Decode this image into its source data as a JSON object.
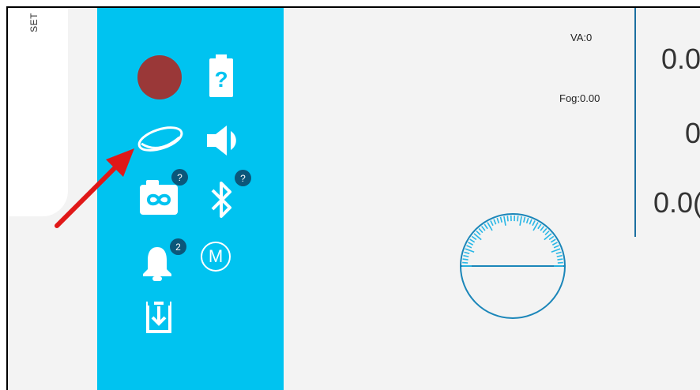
{
  "left_panel": {
    "label": "SET"
  },
  "sidebar": {
    "icons": [
      {
        "name": "record-indicator",
        "color": "#9a3838"
      },
      {
        "name": "battery-unknown-icon"
      },
      {
        "name": "lens-icon"
      },
      {
        "name": "volume-icon"
      },
      {
        "name": "camera-icon",
        "badge": "?"
      },
      {
        "name": "bluetooth-icon",
        "badge": "?"
      },
      {
        "name": "bell-icon",
        "badge": "2"
      },
      {
        "name": "mode-icon",
        "label": "M"
      },
      {
        "name": "download-icon"
      }
    ],
    "background": "#00c3f0"
  },
  "main": {
    "va_label": "VA:0",
    "fog_label": "Fog:0.00",
    "values": [
      "0.0",
      "0",
      "0.0("
    ]
  },
  "annotation": {
    "arrow_color": "#e01818"
  }
}
